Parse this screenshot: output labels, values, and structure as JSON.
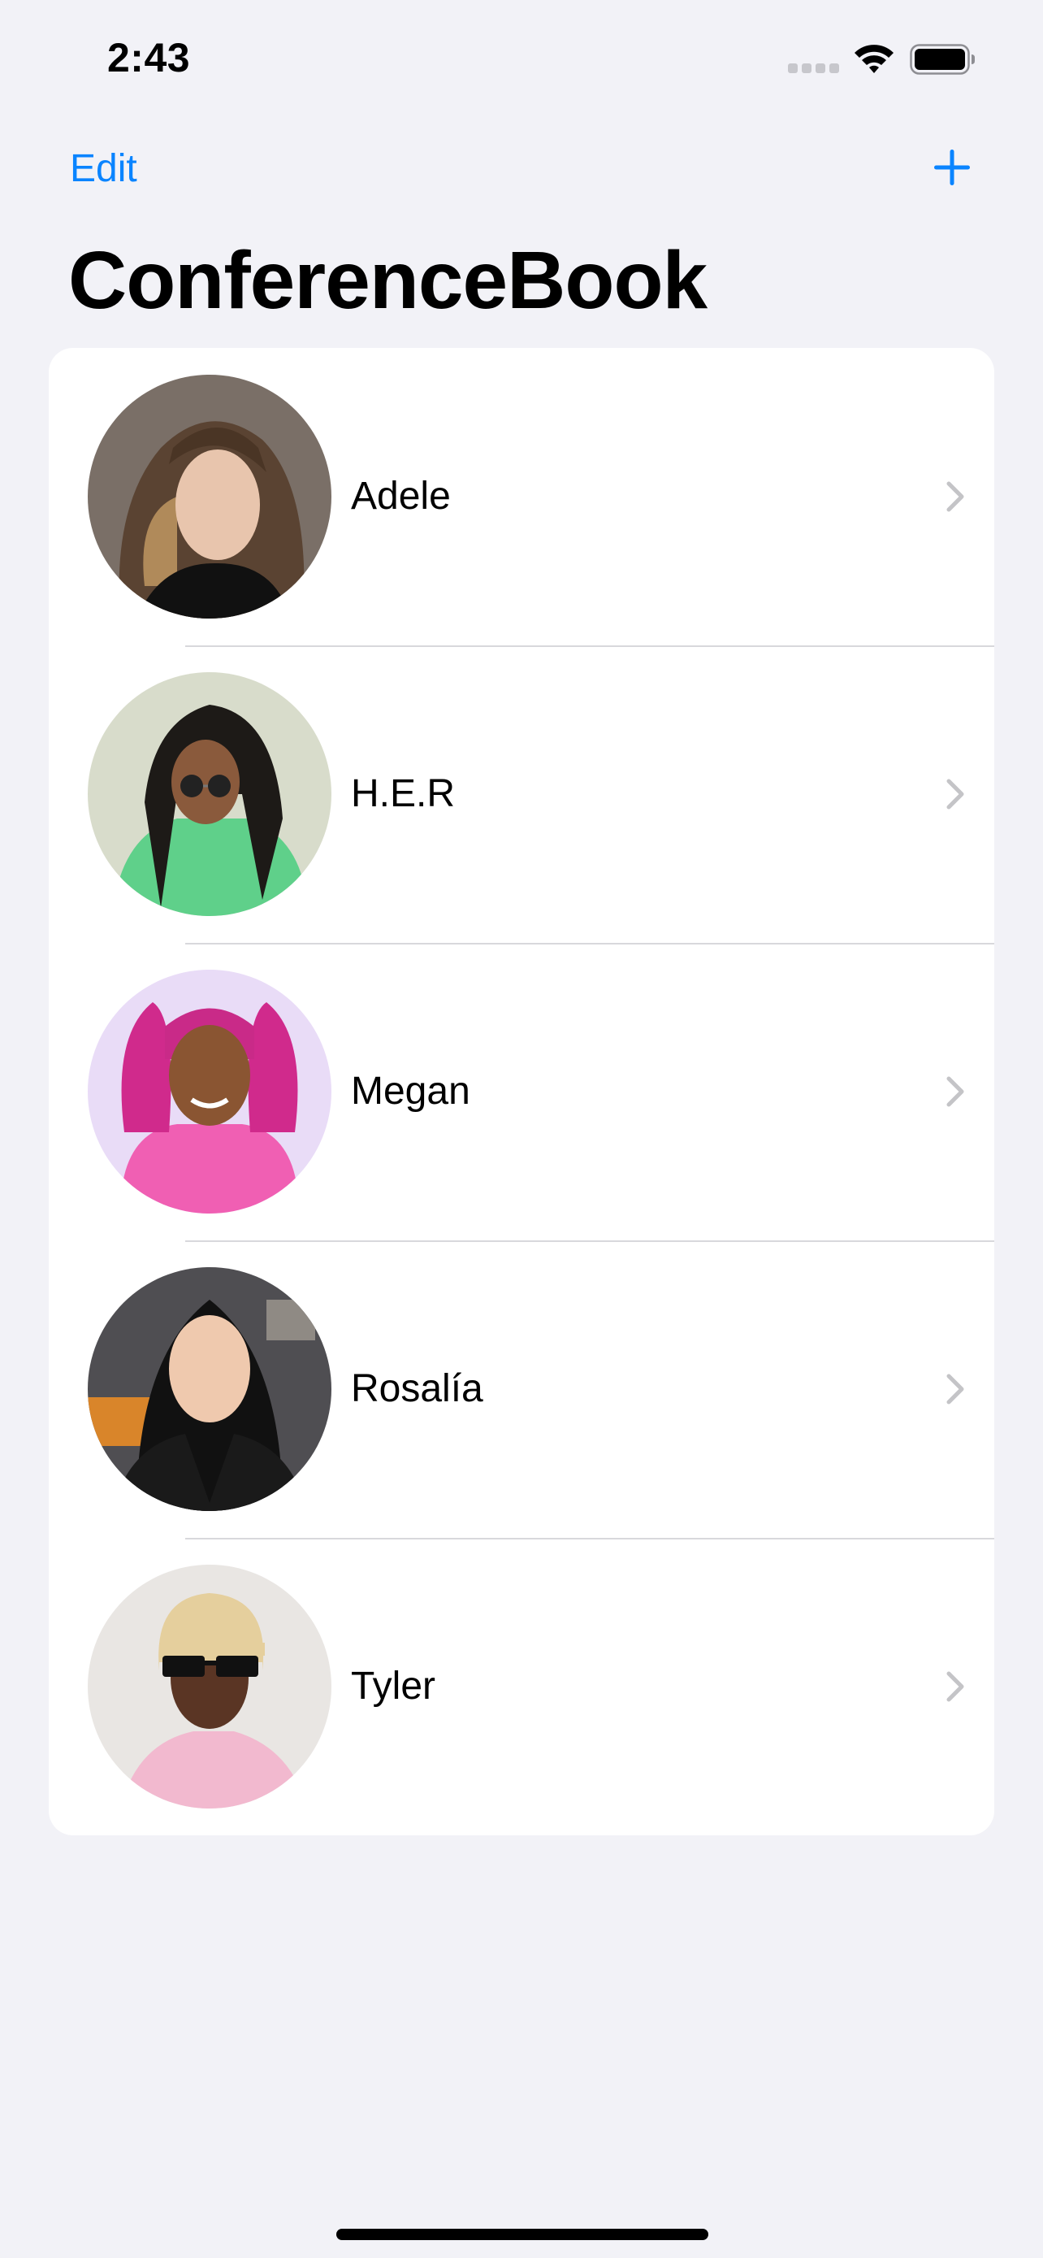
{
  "status_bar": {
    "time": "2:43",
    "icons": [
      "signal-icon",
      "wifi-icon",
      "battery-icon"
    ]
  },
  "nav": {
    "edit_label": "Edit",
    "add_icon": "plus-icon",
    "title": "ConferenceBook"
  },
  "colors": {
    "accent": "#0a84ff",
    "background": "#f2f2f7",
    "card": "#ffffff",
    "separator": "#d8d8dc",
    "chevron": "#c4c4c7"
  },
  "contacts": [
    {
      "name": "Adele"
    },
    {
      "name": "H.E.R"
    },
    {
      "name": "Megan"
    },
    {
      "name": "Rosalía"
    },
    {
      "name": "Tyler"
    }
  ]
}
